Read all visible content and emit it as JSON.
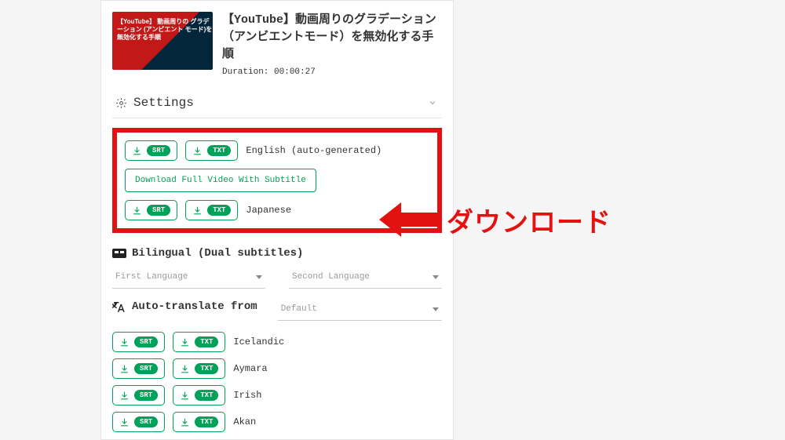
{
  "video": {
    "thumb_caption": "【YouTube】\n動画周りの\nグラデーション\n(アンビエント\nモード)を\n無効化する手順",
    "title": "【YouTube】動画周りのグラデーション（アンビエントモード）を無効化する手順",
    "duration_label": "Duration: 00:00:27"
  },
  "settings_label": "Settings",
  "buttons": {
    "srt": "SRT",
    "txt": "TXT",
    "full_video": "Download Full Video With Subtitle"
  },
  "downloads": {
    "english": "English (auto-generated)",
    "japanese": "Japanese"
  },
  "bilingual": {
    "heading": "Bilingual (Dual subtitles)",
    "first_placeholder": "First Language",
    "second_placeholder": "Second Language"
  },
  "auto_translate": {
    "heading": "Auto-translate from",
    "default_placeholder": "Default",
    "languages": [
      "Icelandic",
      "Aymara",
      "Irish",
      "Akan"
    ]
  },
  "annotation": "ダウンロード"
}
